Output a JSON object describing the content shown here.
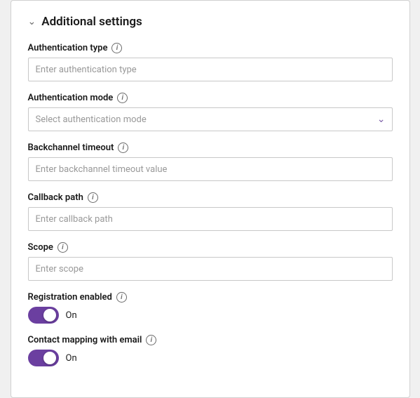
{
  "card": {
    "section_title": "Additional settings",
    "fields": {
      "authentication_type": {
        "label": "Authentication type",
        "placeholder": "Enter authentication type"
      },
      "authentication_mode": {
        "label": "Authentication mode",
        "placeholder": "Select authentication mode"
      },
      "backchannel_timeout": {
        "label": "Backchannel timeout",
        "placeholder": "Enter backchannel timeout value"
      },
      "callback_path": {
        "label": "Callback path",
        "placeholder": "Enter callback path"
      },
      "scope": {
        "label": "Scope",
        "placeholder": "Enter scope"
      },
      "registration_enabled": {
        "label": "Registration enabled",
        "toggle_on_label": "On",
        "is_on": true
      },
      "contact_mapping": {
        "label": "Contact mapping with email",
        "toggle_on_label": "On",
        "is_on": true
      }
    }
  }
}
